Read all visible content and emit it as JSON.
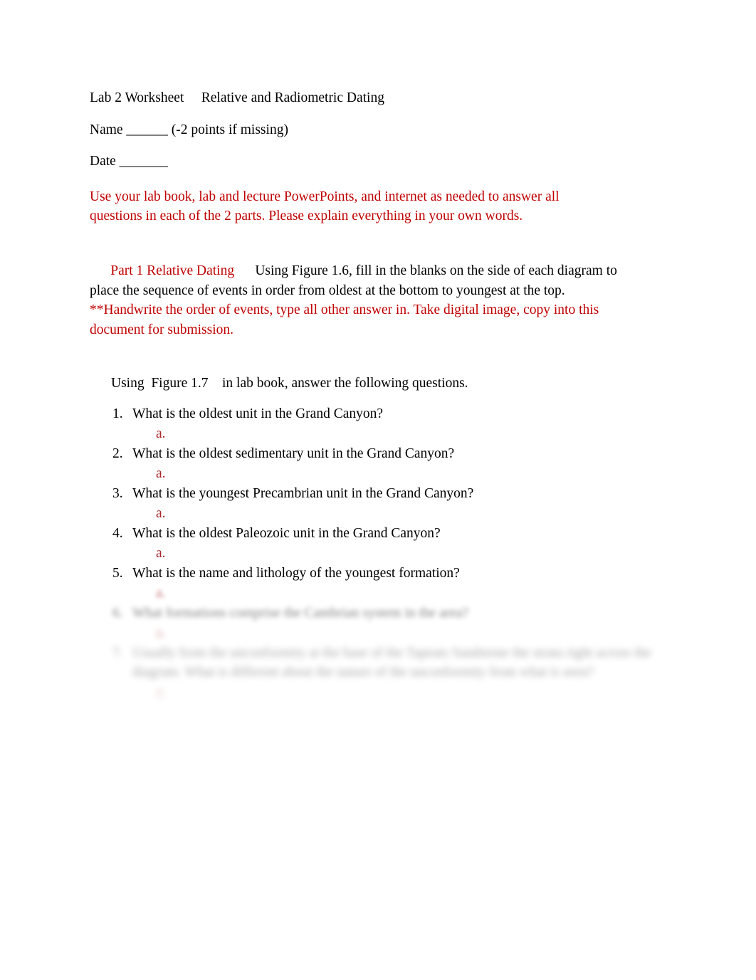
{
  "document": {
    "title_line": "Lab 2 Worksheet     Relative and Radiometric Dating",
    "name_line": "Name ______ (-2 points if missing)",
    "date_line": "Date _______",
    "instructions": "Use your lab book, lab and lecture PowerPoints, and internet as needed to answer all questions in each of the 2 parts. Please explain everything in your own words.",
    "part1": {
      "heading": "Part 1 Relative Dating",
      "body_black_1": "      Using Figure 1.6, fill in the blanks on the side of each diagram to place the sequence of events in order from oldest at the bottom to youngest at the top.  ",
      "body_red": "**Handwrite the order of events, type all other answer in. Take digital image, copy into this document for submission."
    },
    "using_figure_line": "Using  Figure 1.7    in lab book, answer the following questions.",
    "questions": [
      {
        "number": "1.",
        "text": "What is the oldest unit in the Grand Canyon?",
        "answer_marker": "a."
      },
      {
        "number": "2.",
        "text": "What is the oldest sedimentary unit in the Grand Canyon?",
        "answer_marker": "a."
      },
      {
        "number": "3.",
        "text": "What is the youngest Precambrian unit in the Grand Canyon?",
        "answer_marker": "a."
      },
      {
        "number": "4.",
        "text": "What is the oldest Paleozoic unit in the Grand Canyon?",
        "answer_marker": "a."
      },
      {
        "number": "5.",
        "text": "What is the name and lithology of the youngest formation?",
        "answer_marker": "a."
      },
      {
        "number": "6.",
        "text": "What formations comprise the Cambrian system in the area?",
        "answer_marker": "a."
      },
      {
        "number": "7.",
        "text": "Usually from the unconformity at the base of the Tapeats Sandstone the strata right across the diagram. What is different about the nature of the unconformity from what is seen?",
        "answer_marker": "a."
      }
    ]
  },
  "colors": {
    "red_text": "#C00000",
    "red_marker": "#A8272B",
    "body_text": "#000000",
    "page_background": "#FFFFFF"
  }
}
